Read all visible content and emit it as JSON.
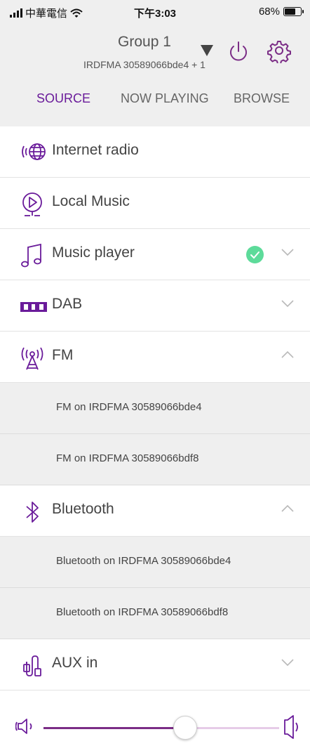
{
  "status_bar": {
    "carrier": "中華電信",
    "time": "下午3:03",
    "battery": "68%",
    "battery_level": 0.68
  },
  "header": {
    "group_title": "Group 1",
    "group_subtitle": "IRDFMA 30589066bde4 + 1",
    "icons": [
      "dropdown-arrow-icon",
      "power-icon",
      "gear-icon"
    ]
  },
  "tabs": [
    {
      "label": "SOURCE",
      "active": true
    },
    {
      "label": "NOW PLAYING",
      "active": false
    },
    {
      "label": "BROWSE",
      "active": false
    }
  ],
  "sources": {
    "internet_radio": {
      "label": "Internet radio",
      "icon": "globe-radio-icon"
    },
    "local_music": {
      "label": "Local Music",
      "icon": "local-music-play-icon"
    },
    "music_player": {
      "label": "Music player",
      "icon": "music-note-icon",
      "selected": true
    },
    "dab": {
      "label": "DAB",
      "icon": "dab-logo-icon"
    },
    "fm": {
      "label": "FM",
      "icon": "fm-antenna-icon",
      "expanded": true,
      "items": [
        "FM on IRDFMA 30589066bde4",
        "FM on IRDFMA 30589066bdf8"
      ]
    },
    "bluetooth": {
      "label": "Bluetooth",
      "icon": "bluetooth-icon",
      "expanded": true,
      "items": [
        "Bluetooth on IRDFMA 30589066bde4",
        "Bluetooth on IRDFMA 30589066bdf8"
      ]
    },
    "aux": {
      "label": "AUX in",
      "icon": "aux-cable-icon"
    }
  },
  "volume": {
    "level": 0.6
  },
  "colors": {
    "accent": "#6a1b9a",
    "header_bg": "#efefef",
    "check_green": "#5ddb9a",
    "slider_fill": "#7b2d86",
    "slider_track": "#e6cce8"
  }
}
